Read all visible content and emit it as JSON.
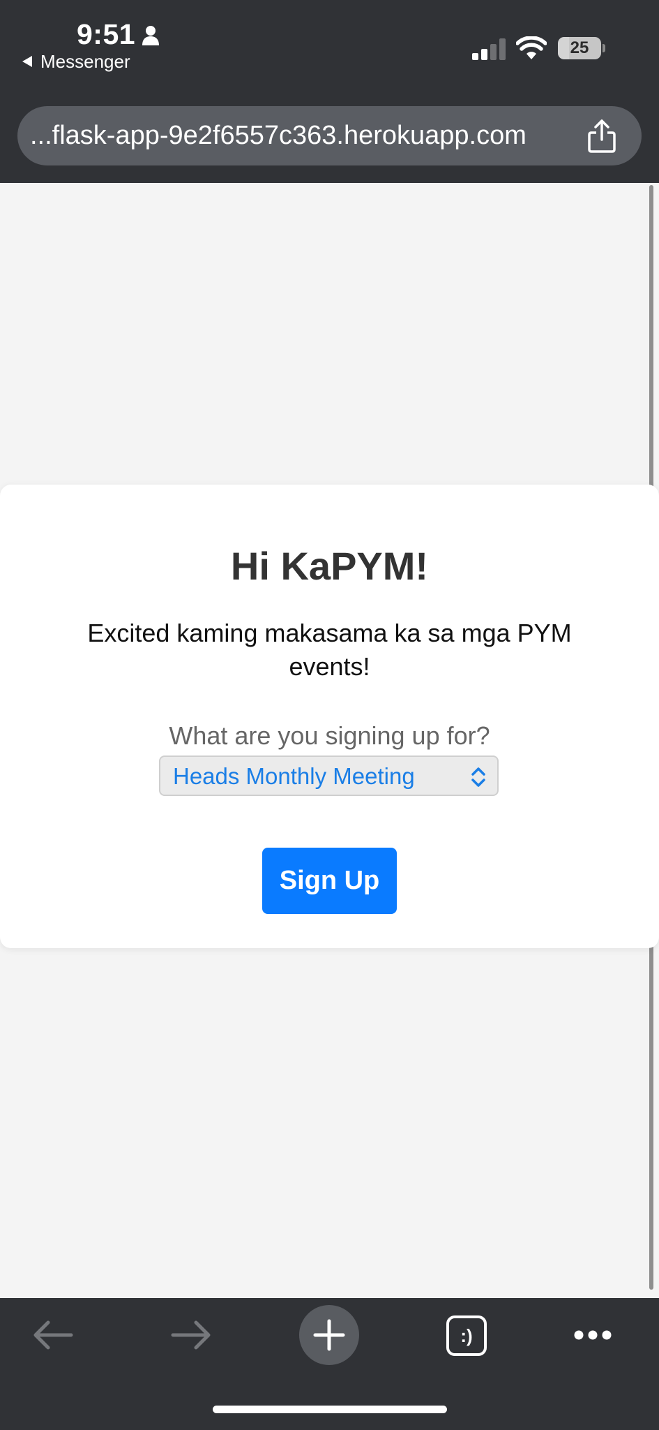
{
  "status_bar": {
    "time": "9:51",
    "back_app": "Messenger",
    "battery": "25",
    "battery_level_percent": 25
  },
  "browser": {
    "url": "...flask-app-9e2f6557c363.herokuapp.com"
  },
  "page": {
    "title": "Hi KaPYM!",
    "subtitle": "Excited kaming makasama ka sa mga PYM events!",
    "select_label": "What are you signing up for?",
    "select_value": "Heads Monthly Meeting",
    "signup_button": "Sign Up"
  },
  "toolbar": {
    "icons": [
      "back-arrow-icon",
      "forward-arrow-icon",
      "new-tab-plus-icon",
      "tabs-icon",
      "more-icon"
    ],
    "tabs_glyph": ":)"
  },
  "colors": {
    "chrome": "#303236",
    "accent": "#0a7bff",
    "select_text": "#1a7ee6",
    "page_bg": "#f4f4f4"
  }
}
